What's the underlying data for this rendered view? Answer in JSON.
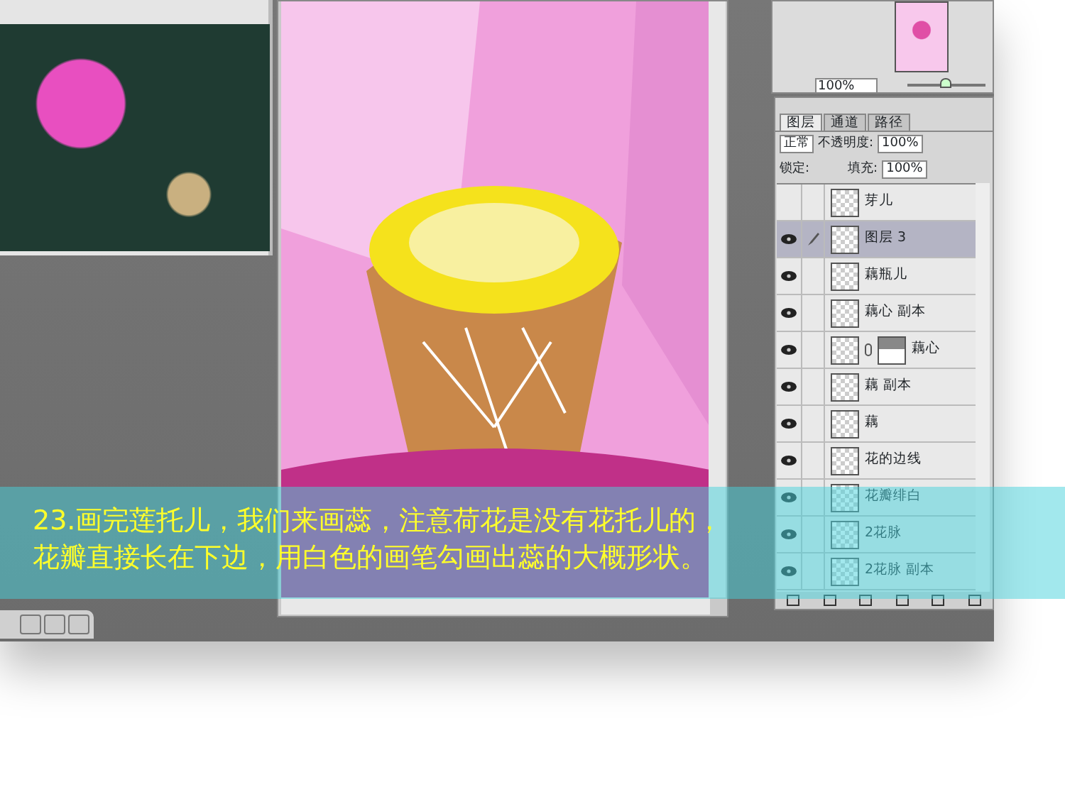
{
  "navigator": {
    "zoom": "100%",
    "level": 0.5
  },
  "layers_panel": {
    "tabs": [
      {
        "label": "图层",
        "selected": true
      },
      {
        "label": "通道",
        "selected": false
      },
      {
        "label": "路径",
        "selected": false
      }
    ],
    "blend_mode": "正常",
    "opacity_label": "不透明度:",
    "opacity": "100%",
    "lock_label": "锁定:",
    "fill_label": "填充:",
    "fill": "100%",
    "layers": [
      {
        "name": "芽儿",
        "visible": false,
        "selected": false,
        "kind": "plain"
      },
      {
        "name": "图层 3",
        "visible": true,
        "selected": true,
        "kind": "plain"
      },
      {
        "name": "藕瓶儿",
        "visible": true,
        "selected": false,
        "kind": "plain"
      },
      {
        "name": "藕心 副本",
        "visible": true,
        "selected": false,
        "kind": "plain"
      },
      {
        "name": "藕心",
        "visible": true,
        "selected": false,
        "kind": "masked"
      },
      {
        "name": "藕 副本",
        "visible": true,
        "selected": false,
        "kind": "plain"
      },
      {
        "name": "藕",
        "visible": true,
        "selected": false,
        "kind": "plain"
      },
      {
        "name": "花的边线",
        "visible": true,
        "selected": false,
        "kind": "plain"
      },
      {
        "name": "花瓣绯白",
        "visible": true,
        "selected": false,
        "kind": "plain"
      },
      {
        "name": "2花脉",
        "visible": true,
        "selected": false,
        "kind": "plain"
      },
      {
        "name": "2花脉 副本",
        "visible": true,
        "selected": false,
        "kind": "plain"
      }
    ]
  },
  "caption": {
    "lines": [
      "23.画完莲托儿，我们来画蕊，注意荷花是没有花托儿的，",
      "花瓣直接长在下边，用白色的画笔勾画出蕊的大概形状。"
    ]
  }
}
